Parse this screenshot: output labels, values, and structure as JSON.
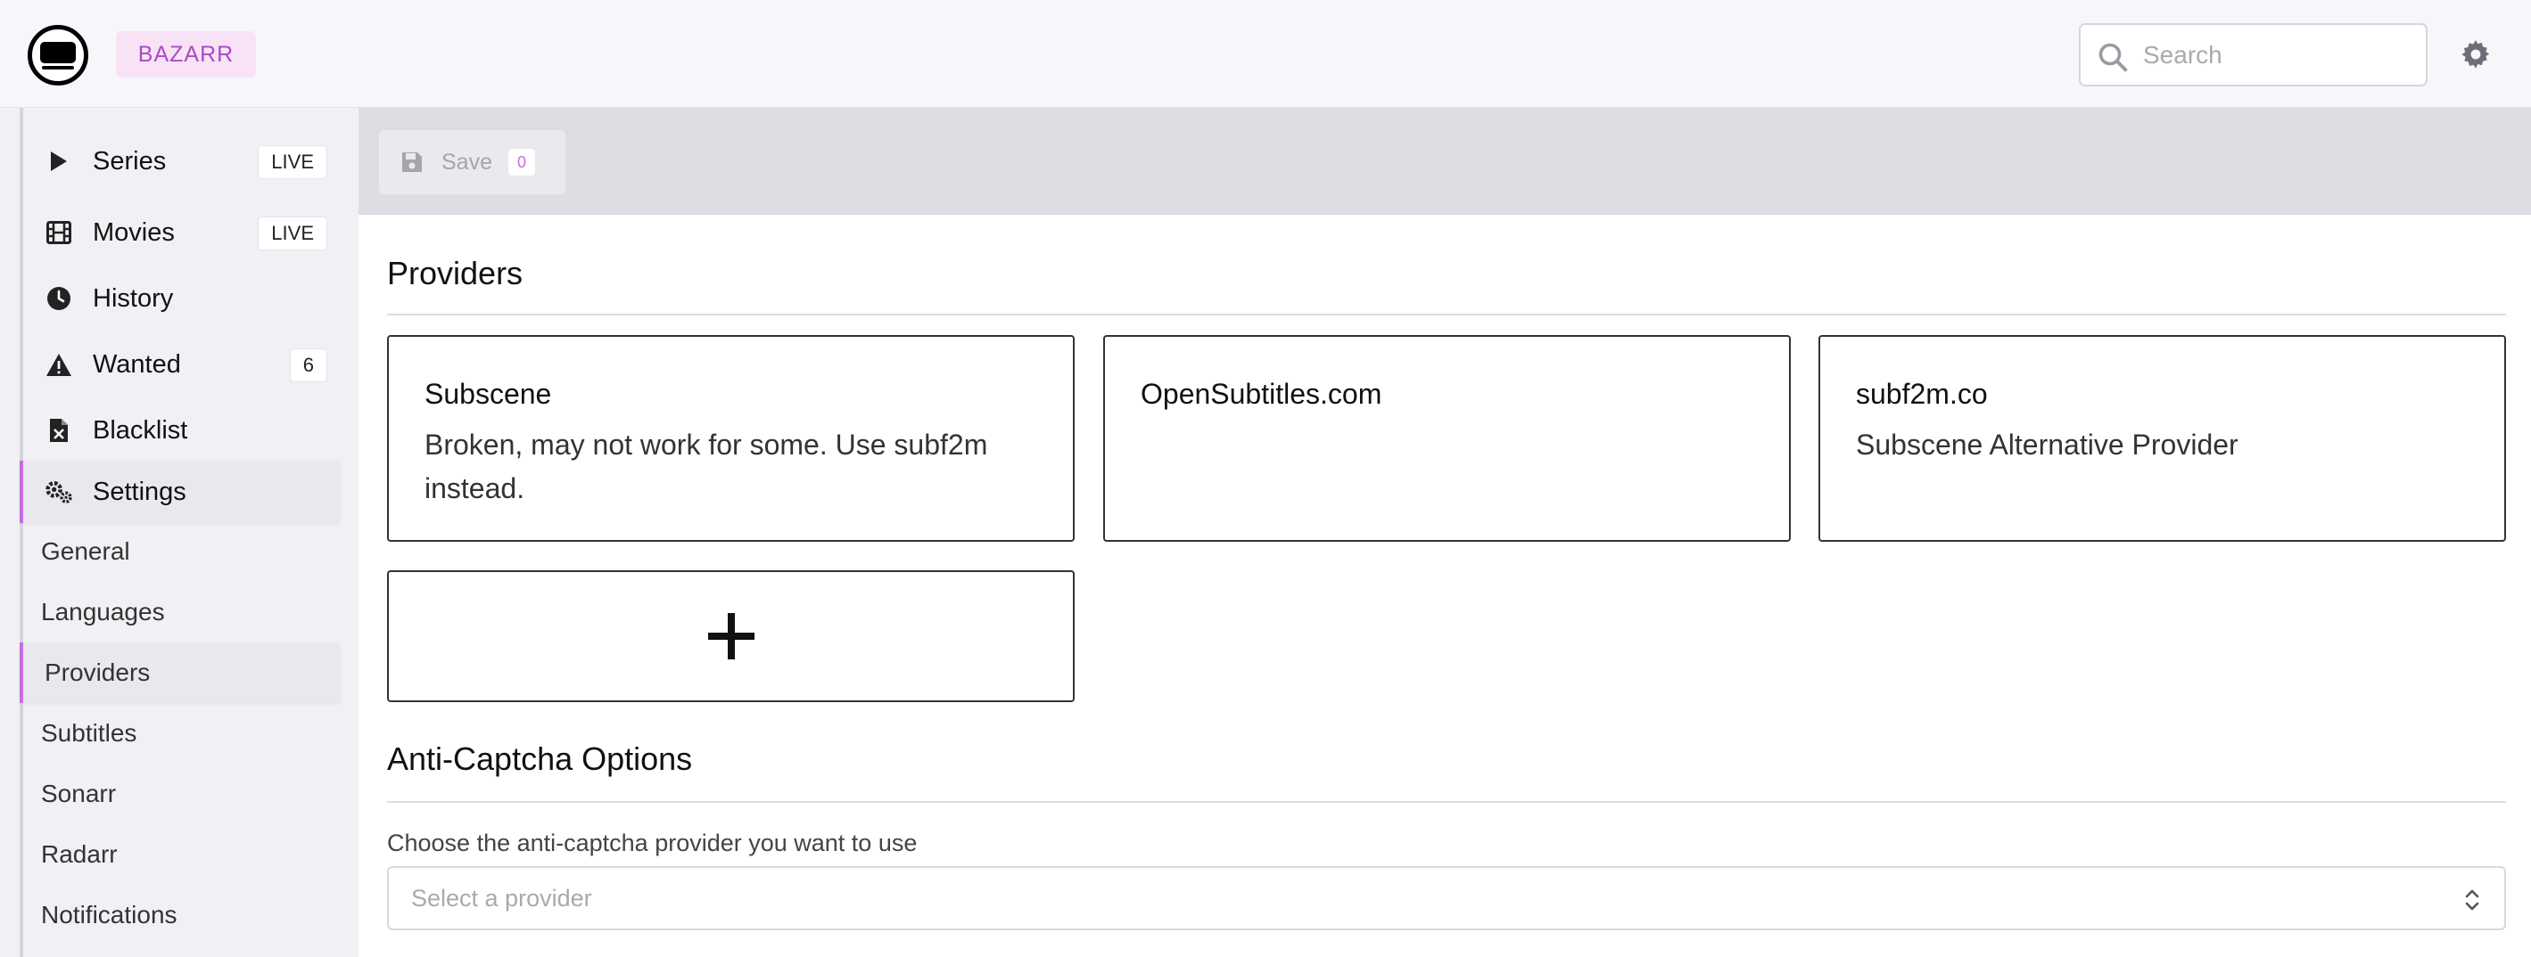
{
  "header": {
    "brand": "BAZARR",
    "search_placeholder": "Search"
  },
  "sidebar": {
    "items": [
      {
        "label": "Series",
        "badge": "LIVE",
        "icon": "play-icon"
      },
      {
        "label": "Movies",
        "badge": "LIVE",
        "icon": "film-icon"
      },
      {
        "label": "History",
        "icon": "clock-icon"
      },
      {
        "label": "Wanted",
        "badge": "6",
        "icon": "warning-icon"
      },
      {
        "label": "Blacklist",
        "icon": "file-excel-icon"
      },
      {
        "label": "Settings",
        "icon": "cogs-icon",
        "active": true
      }
    ],
    "settings_sub": [
      {
        "label": "General"
      },
      {
        "label": "Languages"
      },
      {
        "label": "Providers",
        "active": true
      },
      {
        "label": "Subtitles"
      },
      {
        "label": "Sonarr"
      },
      {
        "label": "Radarr"
      },
      {
        "label": "Notifications"
      }
    ]
  },
  "toolbar": {
    "save_label": "Save",
    "save_count": "0"
  },
  "main": {
    "providers_title": "Providers",
    "providers": [
      {
        "name": "Subscene",
        "description": "Broken, may not work for some. Use subf2m instead."
      },
      {
        "name": "OpenSubtitles.com",
        "description": ""
      },
      {
        "name": "subf2m.co",
        "description": "Subscene Alternative Provider"
      }
    ],
    "anticaptcha_title": "Anti-Captcha Options",
    "anticaptcha_label": "Choose the anti-captcha provider you want to use",
    "anticaptcha_placeholder": "Select a provider"
  },
  "colors": {
    "accent": "#c46ee3",
    "brand_bg": "#f7e3f5",
    "brand_text": "#a94bc6"
  }
}
